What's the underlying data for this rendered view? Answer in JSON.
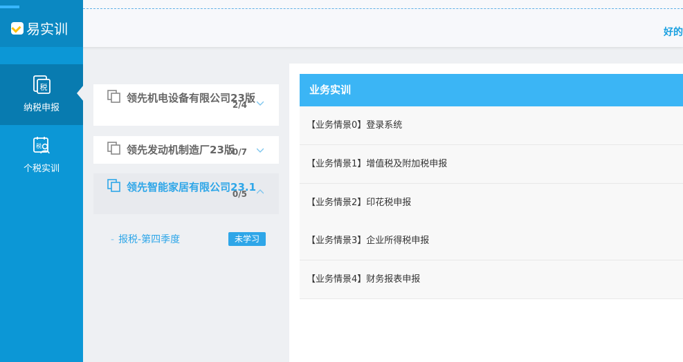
{
  "app": {
    "logo_text": "易实训"
  },
  "topbar": {
    "user_text": "好的"
  },
  "sidebar": {
    "items": [
      {
        "label": "纳税申报",
        "icon": "tax-document-icon",
        "active": true
      },
      {
        "label": "个税实训",
        "icon": "person-tax-icon",
        "active": false
      }
    ]
  },
  "companies": [
    {
      "name": "领先机电设备有限公司23版",
      "count": "2/4",
      "expanded": false
    },
    {
      "name": "领先发动机制造厂23版",
      "count": "0/7",
      "expanded": false
    },
    {
      "name": "领先智能家居有限公司23.1",
      "count": "0/5",
      "expanded": true
    }
  ],
  "sub_item": {
    "label": "报税-第四季度",
    "badge": "未学习"
  },
  "main": {
    "header": "业务实训",
    "scenarios": [
      "【业务情景0】登录系统",
      "【业务情景1】增值税及附加税申报",
      "【业务情景2】印花税申报",
      "【业务情景3】企业所得税申报",
      "【业务情景4】财务报表申报"
    ]
  },
  "colors": {
    "sidebar": "#0c97d6",
    "accent": "#3bb5f5",
    "link": "#2ea6e8"
  }
}
